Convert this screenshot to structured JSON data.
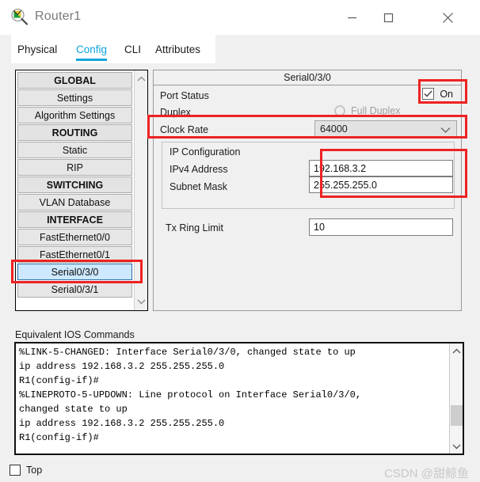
{
  "window": {
    "title": "Router1",
    "icon": "packet-tracer-router-icon",
    "minimize_label": "—",
    "maximize_label": "□",
    "close_label": "✕"
  },
  "tabs": [
    {
      "label": "Physical",
      "active": false
    },
    {
      "label": "Config",
      "active": true
    },
    {
      "label": "CLI",
      "active": false
    },
    {
      "label": "Attributes",
      "active": false
    }
  ],
  "sidebar": {
    "items": [
      {
        "label": "GLOBAL",
        "type": "header"
      },
      {
        "label": "Settings",
        "type": "item"
      },
      {
        "label": "Algorithm Settings",
        "type": "item"
      },
      {
        "label": "ROUTING",
        "type": "header"
      },
      {
        "label": "Static",
        "type": "item"
      },
      {
        "label": "RIP",
        "type": "item"
      },
      {
        "label": "SWITCHING",
        "type": "header"
      },
      {
        "label": "VLAN Database",
        "type": "item"
      },
      {
        "label": "INTERFACE",
        "type": "header"
      },
      {
        "label": "FastEthernet0/0",
        "type": "item"
      },
      {
        "label": "FastEthernet0/1",
        "type": "item"
      },
      {
        "label": "Serial0/3/0",
        "type": "item",
        "selected": true
      },
      {
        "label": "Serial0/3/1",
        "type": "item"
      }
    ]
  },
  "panel": {
    "title": "Serial0/3/0",
    "port_status_label": "Port Status",
    "port_status_value": "On",
    "port_status_checked": true,
    "duplex_label": "Duplex",
    "duplex_option": "Full Duplex",
    "duplex_enabled": false,
    "clock_rate_label": "Clock Rate",
    "clock_rate_value": "64000",
    "ip_configuration_label": "IP Configuration",
    "ipv4_address_label": "IPv4 Address",
    "ipv4_address_value": "192.168.3.2",
    "subnet_mask_label": "Subnet Mask",
    "subnet_mask_value": "255.255.255.0",
    "tx_ring_limit_label": "Tx Ring Limit",
    "tx_ring_limit_value": "10"
  },
  "ios": {
    "title": "Equivalent IOS Commands",
    "text": "%LINK-5-CHANGED: Interface Serial0/3/0, changed state to up\nip address 192.168.3.2 255.255.255.0\nR1(config-if)#\n%LINEPROTO-5-UPDOWN: Line protocol on Interface Serial0/3/0,\nchanged state to up\nip address 192.168.3.2 255.255.255.0\nR1(config-if)#"
  },
  "bottom": {
    "top_checkbox_label": "Top",
    "top_checkbox_checked": false,
    "watermark": "CSDN @甜鲸鱼"
  },
  "annotations": {
    "color": "#ee2222",
    "boxes": [
      {
        "name": "port-status-on"
      },
      {
        "name": "clock-rate-row"
      },
      {
        "name": "ip-config-fields"
      },
      {
        "name": "serial-0-3-0-item"
      }
    ]
  }
}
